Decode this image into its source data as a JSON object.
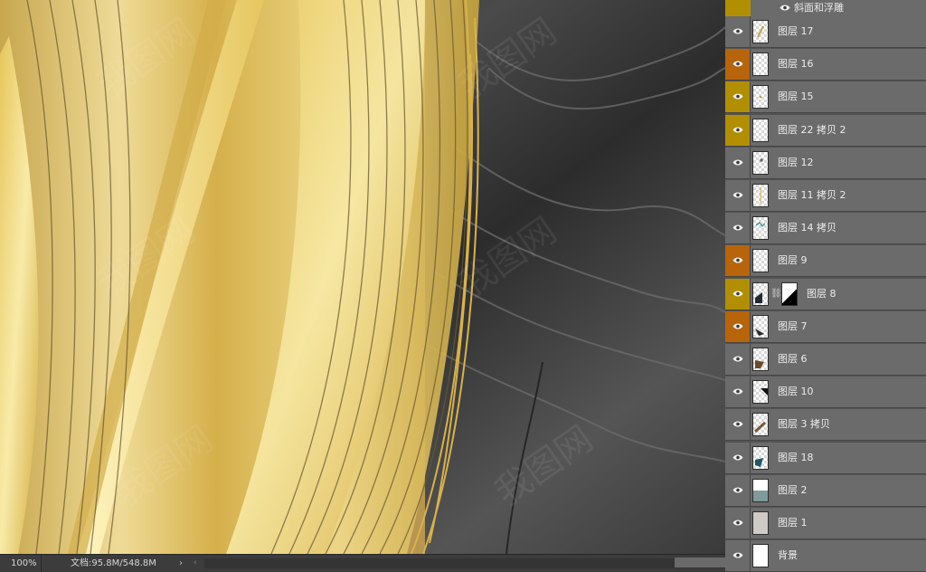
{
  "status_bar": {
    "zoom": "100%",
    "doc_info": "文档:95.8M/548.8M",
    "arrow": "›",
    "scroll_left": "‹"
  },
  "layers_panel": {
    "effect_label": "斜面和浮雕",
    "layers": [
      {
        "name": "图层 17",
        "vis": "none",
        "thumb": "gold-stroke"
      },
      {
        "name": "图层 16",
        "vis": "orange",
        "thumb": "empty"
      },
      {
        "name": "图层 15",
        "vis": "yellow",
        "thumb": "gold-dot"
      },
      {
        "name": "图层 22 拷贝 2",
        "vis": "yellow",
        "thumb": "empty"
      },
      {
        "name": "图层 12",
        "vis": "none",
        "thumb": "grey-dot"
      },
      {
        "name": "图层 11 拷贝 2",
        "vis": "none",
        "thumb": "gold-line"
      },
      {
        "name": "图层 14 拷贝",
        "vis": "none",
        "thumb": "teal-mark"
      },
      {
        "name": "图层 9",
        "vis": "orange",
        "thumb": "empty"
      },
      {
        "name": "图层 8",
        "vis": "yellow",
        "thumb": "dark-corner",
        "has_mask": true
      },
      {
        "name": "图层 7",
        "vis": "orange",
        "thumb": "dark-leaf"
      },
      {
        "name": "图层 6",
        "vis": "none",
        "thumb": "brown-leaf"
      },
      {
        "name": "图层 10",
        "vis": "none",
        "thumb": "black-corner"
      },
      {
        "name": "图层 3 拷贝",
        "vis": "none",
        "thumb": "brown-stroke"
      },
      {
        "name": "图层 18",
        "vis": "none",
        "thumb": "teal-leaf"
      },
      {
        "name": "图层 2",
        "vis": "none",
        "thumb": "teal-block"
      },
      {
        "name": "图层 1",
        "vis": "none",
        "thumb": "grey-fill"
      },
      {
        "name": "背景",
        "vis": "none",
        "thumb": "white-fill"
      }
    ]
  },
  "colors": {
    "gold_base": "#b89550",
    "gold_light": "#f6e49a",
    "marble_dark": "#2a2a2a",
    "orange_highlight": "#b8640a",
    "yellow_highlight": "#b28f00",
    "panel_bg": "#6b6b6b"
  },
  "icons": {
    "visibility": "eye-icon",
    "link": "link-icon"
  }
}
